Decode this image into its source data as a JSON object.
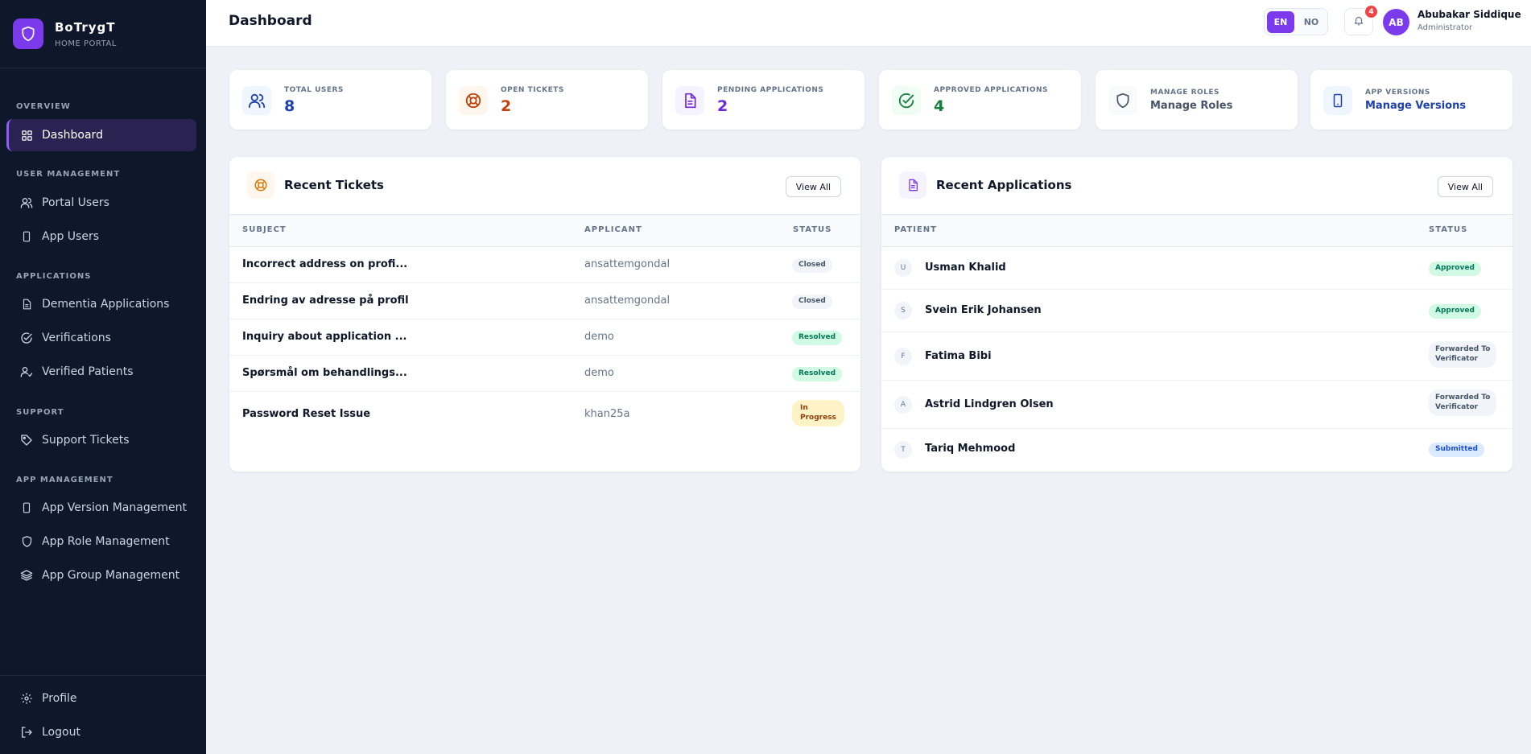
{
  "brand": {
    "name": "BoTrygT",
    "subtitle": "HOME PORTAL"
  },
  "sidebar": {
    "sections": [
      {
        "title": "OVERVIEW"
      },
      {
        "title": "USER MANAGEMENT"
      },
      {
        "title": "APPLICATIONS"
      },
      {
        "title": "SUPPORT"
      },
      {
        "title": "APP MANAGEMENT"
      }
    ],
    "items": [
      {
        "label": "Dashboard",
        "icon": "grid-icon",
        "active": true
      },
      {
        "label": "Portal Users",
        "icon": "users-icon"
      },
      {
        "label": "App Users",
        "icon": "mobile-icon"
      },
      {
        "label": "Dementia Applications",
        "icon": "document-icon"
      },
      {
        "label": "Verifications",
        "icon": "check-circle-icon"
      },
      {
        "label": "Verified Patients",
        "icon": "user-check-icon"
      },
      {
        "label": "Support Tickets",
        "icon": "tag-icon"
      },
      {
        "label": "App Version Management",
        "icon": "mobile-icon"
      },
      {
        "label": "App Role Management",
        "icon": "shield-icon"
      },
      {
        "label": "App Group Management",
        "icon": "layers-icon"
      }
    ],
    "footer": [
      {
        "label": "Profile",
        "icon": "gear-icon"
      },
      {
        "label": "Logout",
        "icon": "logout-icon"
      }
    ]
  },
  "header": {
    "title": "Dashboard",
    "languages": [
      "EN",
      "NO"
    ],
    "active_language": "EN",
    "notifications_count": "4",
    "user": {
      "initials": "AB",
      "name": "Abubakar Siddique",
      "role": "Administrator"
    }
  },
  "stats": [
    {
      "label": "TOTAL USERS",
      "value": "8",
      "icon": "users-icon",
      "color": "#1e40af",
      "bg": "#eff6ff"
    },
    {
      "label": "OPEN TICKETS",
      "value": "2",
      "icon": "lifebuoy-icon",
      "color": "#c2410c",
      "bg": "#fff7ed"
    },
    {
      "label": "PENDING APPLICATIONS",
      "value": "2",
      "icon": "document-icon",
      "color": "#6d28d9",
      "bg": "#f5f3ff"
    },
    {
      "label": "APPROVED APPLICATIONS",
      "value": "4",
      "icon": "check-circle-icon",
      "color": "#15803d",
      "bg": "#f0fdf4"
    },
    {
      "label": "MANAGE ROLES",
      "value": "Manage Roles",
      "icon": "shield-icon",
      "color": "#475569",
      "bg": "#f8fafc"
    },
    {
      "label": "APP VERSIONS",
      "value": "Manage Versions",
      "icon": "mobile-icon",
      "color": "#1e40af",
      "bg": "#eff6ff"
    }
  ],
  "tickets": {
    "title": "Recent Tickets",
    "view_all": "View All",
    "columns": [
      "SUBJECT",
      "APPLICANT",
      "STATUS"
    ],
    "rows": [
      {
        "subject": "Incorrect address on profi...",
        "applicant": "ansattemgondal",
        "status": "Closed",
        "kind": "closed"
      },
      {
        "subject": "Endring av adresse på profil",
        "applicant": "ansattemgondal",
        "status": "Closed",
        "kind": "closed"
      },
      {
        "subject": "Inquiry about application ...",
        "applicant": "demo",
        "status": "Resolved",
        "kind": "resolved"
      },
      {
        "subject": "Spørsmål om behandlings...",
        "applicant": "demo",
        "status": "Resolved",
        "kind": "resolved"
      },
      {
        "subject": "Password Reset Issue",
        "applicant": "khan25a",
        "status_lines": [
          "In",
          "Progress"
        ],
        "kind": "progress"
      }
    ]
  },
  "applications": {
    "title": "Recent Applications",
    "view_all": "View All",
    "columns": [
      "PATIENT",
      "STATUS"
    ],
    "rows": [
      {
        "initial": "U",
        "name": "Usman Khalid",
        "status": "Approved",
        "kind": "approved"
      },
      {
        "initial": "S",
        "name": "Svein Erik Johansen",
        "status": "Approved",
        "kind": "approved"
      },
      {
        "initial": "F",
        "name": "Fatima Bibi",
        "status_lines": [
          "Forwarded To",
          "Verificator"
        ],
        "kind": "forwarded"
      },
      {
        "initial": "A",
        "name": "Astrid Lindgren Olsen",
        "status_lines": [
          "Forwarded To",
          "Verificator"
        ],
        "kind": "forwarded"
      },
      {
        "initial": "T",
        "name": "Tariq Mehmood",
        "status": "Submitted",
        "kind": "submitted"
      }
    ]
  }
}
